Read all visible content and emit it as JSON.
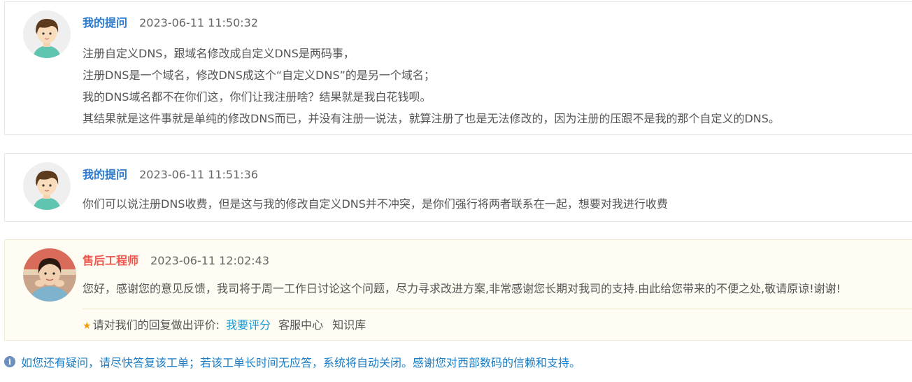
{
  "messages": [
    {
      "author": "我的提问",
      "time": "2023-06-11 11:50:32",
      "lines": [
        "注册自定义DNS，跟域名修改成自定义DNS是两码事，",
        "注册DNS是一个域名，修改DNS成这个“自定义DNS”的是另一个域名；",
        "我的DNS域名都不在你们这，你们让我注册啥？结果就是我白花钱呗。",
        "其结果就是这件事就是单纯的修改DNS而已，并没有注册一说法，就算注册了也是无法修改的，因为注册的压跟不是我的那个自定义的DNS。"
      ]
    },
    {
      "author": "我的提问",
      "time": "2023-06-11 11:51:36",
      "lines": [
        "你们可以说注册DNS收费，但是这与我的修改自定义DNS并不冲突，是你们强行将两者联系在一起，想要对我进行收费"
      ]
    },
    {
      "author": "售后工程师",
      "time": "2023-06-11 12:02:43",
      "lines": [
        "您好，感谢您的意见反馈，我司将于周一工作日讨论这个问题，尽力寻求改进方案,非常感谢您长期对我司的支持.由此给您带来的不便之处,敬请原谅!谢谢!"
      ]
    }
  ],
  "rating": {
    "prompt": "请对我们的回复做出评价:",
    "rate_link": "我要评分",
    "service_link": "客服中心",
    "kb_link": "知识库"
  },
  "notice": "如您还有疑问，请尽快答复该工单；若该工单长时间无应答，系统将自动关闭。感谢您对西部数码的信赖和支持。",
  "icons": {
    "user_avatar": "cartoon-boy-avatar",
    "staff_avatar": "engineer-photo-avatar",
    "star": "star-icon",
    "info": "info-icon"
  },
  "colors": {
    "user_name": "#2b7bd0",
    "staff_name": "#f0584f",
    "link": "#1a9bd7",
    "notice": "#1a7dc4",
    "star": "#f39c12"
  }
}
